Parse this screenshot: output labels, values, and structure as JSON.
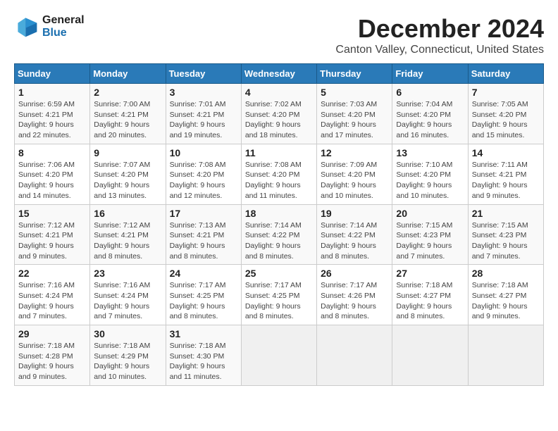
{
  "logo": {
    "line1": "General",
    "line2": "Blue"
  },
  "title": "December 2024",
  "subtitle": "Canton Valley, Connecticut, United States",
  "days_header": [
    "Sunday",
    "Monday",
    "Tuesday",
    "Wednesday",
    "Thursday",
    "Friday",
    "Saturday"
  ],
  "weeks": [
    [
      {
        "day": "1",
        "info": "Sunrise: 6:59 AM\nSunset: 4:21 PM\nDaylight: 9 hours\nand 22 minutes."
      },
      {
        "day": "2",
        "info": "Sunrise: 7:00 AM\nSunset: 4:21 PM\nDaylight: 9 hours\nand 20 minutes."
      },
      {
        "day": "3",
        "info": "Sunrise: 7:01 AM\nSunset: 4:21 PM\nDaylight: 9 hours\nand 19 minutes."
      },
      {
        "day": "4",
        "info": "Sunrise: 7:02 AM\nSunset: 4:20 PM\nDaylight: 9 hours\nand 18 minutes."
      },
      {
        "day": "5",
        "info": "Sunrise: 7:03 AM\nSunset: 4:20 PM\nDaylight: 9 hours\nand 17 minutes."
      },
      {
        "day": "6",
        "info": "Sunrise: 7:04 AM\nSunset: 4:20 PM\nDaylight: 9 hours\nand 16 minutes."
      },
      {
        "day": "7",
        "info": "Sunrise: 7:05 AM\nSunset: 4:20 PM\nDaylight: 9 hours\nand 15 minutes."
      }
    ],
    [
      {
        "day": "8",
        "info": "Sunrise: 7:06 AM\nSunset: 4:20 PM\nDaylight: 9 hours\nand 14 minutes."
      },
      {
        "day": "9",
        "info": "Sunrise: 7:07 AM\nSunset: 4:20 PM\nDaylight: 9 hours\nand 13 minutes."
      },
      {
        "day": "10",
        "info": "Sunrise: 7:08 AM\nSunset: 4:20 PM\nDaylight: 9 hours\nand 12 minutes."
      },
      {
        "day": "11",
        "info": "Sunrise: 7:08 AM\nSunset: 4:20 PM\nDaylight: 9 hours\nand 11 minutes."
      },
      {
        "day": "12",
        "info": "Sunrise: 7:09 AM\nSunset: 4:20 PM\nDaylight: 9 hours\nand 10 minutes."
      },
      {
        "day": "13",
        "info": "Sunrise: 7:10 AM\nSunset: 4:20 PM\nDaylight: 9 hours\nand 10 minutes."
      },
      {
        "day": "14",
        "info": "Sunrise: 7:11 AM\nSunset: 4:21 PM\nDaylight: 9 hours\nand 9 minutes."
      }
    ],
    [
      {
        "day": "15",
        "info": "Sunrise: 7:12 AM\nSunset: 4:21 PM\nDaylight: 9 hours\nand 9 minutes."
      },
      {
        "day": "16",
        "info": "Sunrise: 7:12 AM\nSunset: 4:21 PM\nDaylight: 9 hours\nand 8 minutes."
      },
      {
        "day": "17",
        "info": "Sunrise: 7:13 AM\nSunset: 4:21 PM\nDaylight: 9 hours\nand 8 minutes."
      },
      {
        "day": "18",
        "info": "Sunrise: 7:14 AM\nSunset: 4:22 PM\nDaylight: 9 hours\nand 8 minutes."
      },
      {
        "day": "19",
        "info": "Sunrise: 7:14 AM\nSunset: 4:22 PM\nDaylight: 9 hours\nand 8 minutes."
      },
      {
        "day": "20",
        "info": "Sunrise: 7:15 AM\nSunset: 4:23 PM\nDaylight: 9 hours\nand 7 minutes."
      },
      {
        "day": "21",
        "info": "Sunrise: 7:15 AM\nSunset: 4:23 PM\nDaylight: 9 hours\nand 7 minutes."
      }
    ],
    [
      {
        "day": "22",
        "info": "Sunrise: 7:16 AM\nSunset: 4:24 PM\nDaylight: 9 hours\nand 7 minutes."
      },
      {
        "day": "23",
        "info": "Sunrise: 7:16 AM\nSunset: 4:24 PM\nDaylight: 9 hours\nand 7 minutes."
      },
      {
        "day": "24",
        "info": "Sunrise: 7:17 AM\nSunset: 4:25 PM\nDaylight: 9 hours\nand 8 minutes."
      },
      {
        "day": "25",
        "info": "Sunrise: 7:17 AM\nSunset: 4:25 PM\nDaylight: 9 hours\nand 8 minutes."
      },
      {
        "day": "26",
        "info": "Sunrise: 7:17 AM\nSunset: 4:26 PM\nDaylight: 9 hours\nand 8 minutes."
      },
      {
        "day": "27",
        "info": "Sunrise: 7:18 AM\nSunset: 4:27 PM\nDaylight: 9 hours\nand 8 minutes."
      },
      {
        "day": "28",
        "info": "Sunrise: 7:18 AM\nSunset: 4:27 PM\nDaylight: 9 hours\nand 9 minutes."
      }
    ],
    [
      {
        "day": "29",
        "info": "Sunrise: 7:18 AM\nSunset: 4:28 PM\nDaylight: 9 hours\nand 9 minutes."
      },
      {
        "day": "30",
        "info": "Sunrise: 7:18 AM\nSunset: 4:29 PM\nDaylight: 9 hours\nand 10 minutes."
      },
      {
        "day": "31",
        "info": "Sunrise: 7:18 AM\nSunset: 4:30 PM\nDaylight: 9 hours\nand 11 minutes."
      },
      null,
      null,
      null,
      null
    ]
  ]
}
